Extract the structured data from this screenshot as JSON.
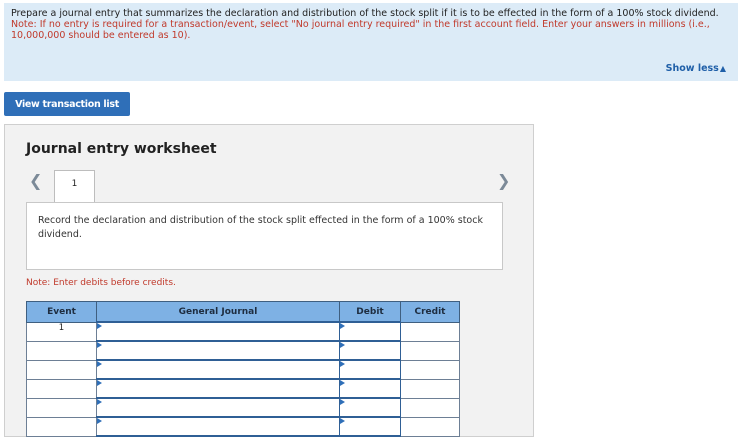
{
  "instructions": {
    "main": "Prepare a journal entry that summarizes the declaration and distribution of the stock split if it is to be effected in the form of a 100% stock dividend.",
    "note": "Note: If no entry is required for a transaction/event, select \"No journal entry required\" in the first account field. Enter your answers in millions (i.e., 10,000,000 should be entered as 10).",
    "show_less": "Show less"
  },
  "view_transaction_button": "View transaction list",
  "worksheet": {
    "title": "Journal entry worksheet",
    "tab_label": "1",
    "description": "Record the declaration and distribution of the stock split effected in the form of a 100% stock dividend.",
    "note": "Note: Enter debits before credits.",
    "table": {
      "headers": {
        "event": "Event",
        "general_journal": "General Journal",
        "debit": "Debit",
        "credit": "Credit"
      },
      "rows": [
        {
          "event": "1"
        },
        {
          "event": ""
        },
        {
          "event": ""
        },
        {
          "event": ""
        },
        {
          "event": ""
        },
        {
          "event": ""
        }
      ]
    }
  }
}
